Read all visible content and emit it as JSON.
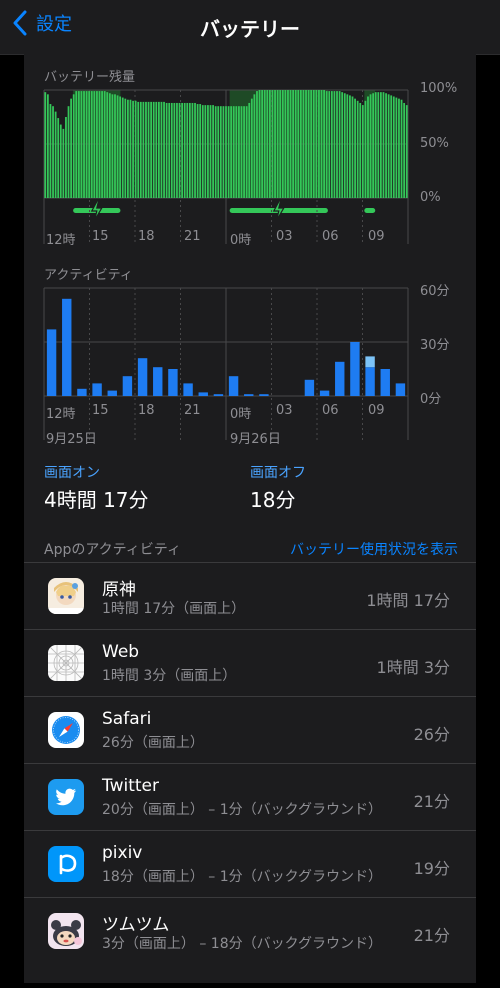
{
  "nav": {
    "back_label": "設定",
    "title": "バッテリー"
  },
  "battery_chart": {
    "label": "バッテリー残量",
    "y_ticks": [
      "100%",
      "50%",
      "0%"
    ],
    "x_ticks": [
      "12時",
      "15",
      "18",
      "21",
      "0時",
      "03",
      "06",
      "09"
    ]
  },
  "activity_chart": {
    "label": "アクティビティ",
    "y_ticks": [
      "60分",
      "30分",
      "0分"
    ],
    "x_ticks": [
      "12時",
      "15",
      "18",
      "21",
      "0時",
      "03",
      "06",
      "09"
    ],
    "dates": [
      "9月25日",
      "9月26日"
    ]
  },
  "chart_data": [
    {
      "type": "bar",
      "title": "バッテリー残量",
      "ylim": [
        0,
        100
      ],
      "unit": "%",
      "values": [
        98,
        96,
        87,
        85,
        80,
        74,
        68,
        64,
        75,
        85,
        92,
        96,
        99,
        99,
        99,
        99,
        99,
        99,
        99,
        99,
        99,
        99,
        99,
        99,
        98,
        97,
        96,
        96,
        95,
        94,
        93,
        92,
        91,
        91,
        90,
        90,
        89,
        89,
        89,
        89,
        89,
        89,
        89,
        89,
        89,
        89,
        89,
        88,
        88,
        88,
        88,
        88,
        88,
        88,
        88,
        88,
        88,
        88,
        88,
        87,
        87,
        86,
        86,
        86,
        86,
        86,
        85,
        85,
        85,
        85,
        85,
        85,
        85,
        85,
        85,
        85,
        85,
        85,
        85,
        88,
        92,
        96,
        99,
        100,
        100,
        100,
        100,
        100,
        100,
        100,
        100,
        100,
        100,
        100,
        100,
        100,
        100,
        100,
        100,
        100,
        100,
        100,
        100,
        100,
        100,
        100,
        100,
        100,
        100,
        99,
        99,
        99,
        99,
        99,
        99,
        98,
        97,
        96,
        95,
        94,
        92,
        90,
        88,
        86,
        90,
        94,
        96,
        97,
        98,
        98,
        98,
        98,
        97,
        96,
        95,
        94,
        93,
        92,
        91,
        88,
        86
      ],
      "charging": [
        [
          0.08,
          0.21
        ],
        [
          0.51,
          0.78
        ],
        [
          0.88,
          0.91
        ]
      ]
    },
    {
      "type": "bar",
      "title": "アクティビティ",
      "ylim": [
        0,
        60
      ],
      "unit": "分",
      "categories": [
        "12",
        "13",
        "14",
        "15",
        "16",
        "17",
        "18",
        "19",
        "20",
        "21",
        "22",
        "23",
        "0",
        "1",
        "2",
        "3",
        "4",
        "5",
        "6",
        "7",
        "8",
        "9",
        "10",
        "11"
      ],
      "series": [
        {
          "values": [
            37,
            54,
            4,
            7,
            3,
            11,
            21,
            16,
            15,
            7,
            2,
            1,
            11,
            1,
            1,
            0,
            0,
            9,
            3,
            19,
            30,
            16,
            15,
            7
          ]
        },
        {
          "values": [
            0,
            0,
            0,
            0,
            0,
            0,
            0,
            0,
            0,
            0,
            0,
            0,
            0,
            0,
            0,
            0,
            0,
            0,
            0,
            0,
            0,
            6,
            0,
            0
          ]
        }
      ]
    }
  ],
  "stats": {
    "screen_on_label": "画面オン",
    "screen_on_value": "4時間 17分",
    "screen_off_label": "画面オフ",
    "screen_off_value": "18分"
  },
  "app_activity": {
    "header": "Appのアクティビティ",
    "show_usage_link": "バッテリー使用状況を表示",
    "apps": [
      {
        "name": "原神",
        "detail": "1時間 17分（画面上）",
        "time": "1時間 17分",
        "icon": "genshin-icon"
      },
      {
        "name": "Web",
        "detail": "1時間 3分（画面上）",
        "time": "1時間 3分",
        "icon": "web-icon"
      },
      {
        "name": "Safari",
        "detail": "26分（画面上）",
        "time": "26分",
        "icon": "safari-icon"
      },
      {
        "name": "Twitter",
        "detail": "20分（画面上） – 1分（バックグラウンド）",
        "time": "21分",
        "icon": "twitter-icon"
      },
      {
        "name": "pixiv",
        "detail": "18分（画面上） – 1分（バックグラウンド）",
        "time": "19分",
        "icon": "pixiv-icon"
      },
      {
        "name": "ツムツム",
        "detail": "3分（画面上） – 18分（バックグラウンド）",
        "time": "21分",
        "icon": "tsumtsum-icon"
      }
    ]
  },
  "colors": {
    "accent": "#0a84ff",
    "battery_bar": "#34c759",
    "charging_bg": "#1e4a26",
    "activity_bar": "#1e7cf2",
    "activity_bg_bar": "#7cc3f7"
  }
}
